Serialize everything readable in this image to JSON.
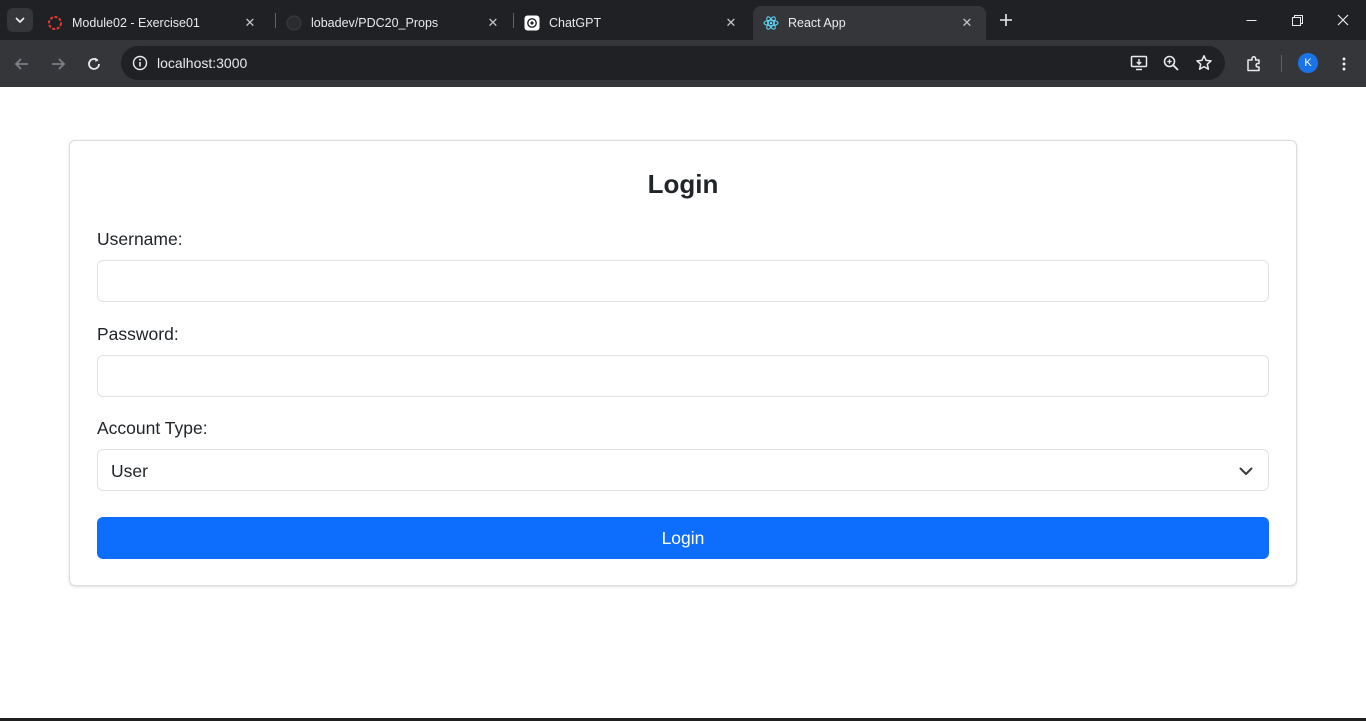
{
  "browser": {
    "tabs": [
      {
        "title": "Module02 - Exercise01",
        "favicon": "ring-logo-icon",
        "active": false
      },
      {
        "title": "lobadev/PDC20_Props",
        "favicon": "github-icon",
        "active": false
      },
      {
        "title": "ChatGPT",
        "favicon": "chatgpt-icon",
        "active": false
      },
      {
        "title": "React App",
        "favicon": "react-icon",
        "active": true
      }
    ],
    "url": "localhost:3000",
    "profile_initial": "K",
    "accent": "#1a73e8"
  },
  "page": {
    "heading": "Login",
    "username_label": "Username:",
    "username_value": "",
    "password_label": "Password:",
    "password_value": "",
    "account_type_label": "Account Type:",
    "account_type_selected": "User",
    "submit_label": "Login",
    "button_color": "#0d6efd"
  }
}
